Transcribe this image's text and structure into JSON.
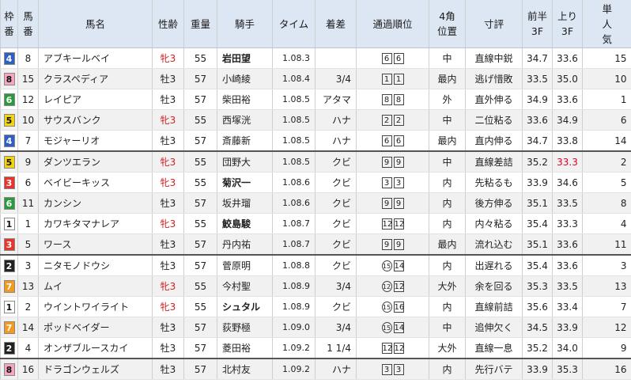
{
  "headers": {
    "waku": [
      "枠",
      "番"
    ],
    "umaban": [
      "馬",
      "番"
    ],
    "horse": "馬名",
    "sexage": "性齢",
    "weight": "重量",
    "jockey": "騎手",
    "time": "タイム",
    "margin": "着差",
    "passing": "通過順位",
    "corner4": [
      "4角",
      "位置"
    ],
    "comment": "寸評",
    "first3f": [
      "前半",
      "3F"
    ],
    "last3f": [
      "上り",
      "3F"
    ],
    "pop": [
      "単",
      "人",
      "気"
    ]
  },
  "colors": {
    "waku1": "#ffffff",
    "waku2": "#222222",
    "waku3": "#e8342c",
    "waku4": "#2f5fc4",
    "waku5": "#f2d30f",
    "waku6": "#2a9a3c",
    "waku7": "#f39a1c",
    "waku8": "#f6a6c2",
    "header_bg": "#dde6f3",
    "highlight": "#e00028"
  },
  "rows": [
    {
      "waku": "4",
      "num": "8",
      "horse": "アブキールベイ",
      "sex": "牝3",
      "weight": "55",
      "jockey": "岩田望",
      "jockey_bold": true,
      "time": "1.08.3",
      "margin": "",
      "pass": [
        "6",
        "6"
      ],
      "c4": "中",
      "comment": "直線中鋭",
      "f3": "34.7",
      "l3": "33.6",
      "pop": "15"
    },
    {
      "waku": "8",
      "num": "15",
      "horse": "クラスペディア",
      "sex": "牡3",
      "weight": "57",
      "jockey": "小崎綾",
      "jockey_bold": false,
      "time": "1.08.4",
      "margin": "3/4",
      "pass": [
        "1",
        "1"
      ],
      "c4": "最内",
      "comment": "逃げ惜敗",
      "f3": "33.5",
      "l3": "35.0",
      "pop": "10"
    },
    {
      "waku": "6",
      "num": "12",
      "horse": "レイピア",
      "sex": "牡3",
      "weight": "57",
      "jockey": "柴田裕",
      "jockey_bold": false,
      "time": "1.08.5",
      "margin": "アタマ",
      "pass": [
        "8",
        "8"
      ],
      "c4": "外",
      "comment": "直外伸る",
      "f3": "34.9",
      "l3": "33.6",
      "pop": "1"
    },
    {
      "waku": "5",
      "num": "10",
      "horse": "サウスバンク",
      "sex": "牝3",
      "weight": "55",
      "jockey": "西塚洸",
      "jockey_bold": false,
      "time": "1.08.5",
      "margin": "ハナ",
      "pass": [
        "2",
        "2"
      ],
      "c4": "中",
      "comment": "二位粘る",
      "f3": "33.6",
      "l3": "34.9",
      "pop": "6"
    },
    {
      "waku": "4",
      "num": "7",
      "horse": "モジャーリオ",
      "sex": "牡3",
      "weight": "57",
      "jockey": "斎藤新",
      "jockey_bold": false,
      "time": "1.08.5",
      "margin": "ハナ",
      "pass": [
        "6",
        "6"
      ],
      "c4": "最内",
      "comment": "直内伸る",
      "f3": "34.7",
      "l3": "33.8",
      "pop": "14"
    },
    {
      "waku": "5",
      "num": "9",
      "horse": "ダンツエラン",
      "sex": "牝3",
      "weight": "55",
      "jockey": "団野大",
      "jockey_bold": false,
      "time": "1.08.5",
      "margin": "クビ",
      "pass": [
        "9",
        "9"
      ],
      "c4": "中",
      "comment": "直線差詰",
      "f3": "35.2",
      "l3": "33.3",
      "pop": "2",
      "l3_hl": true
    },
    {
      "waku": "3",
      "num": "6",
      "horse": "ベイビーキッス",
      "sex": "牝3",
      "weight": "55",
      "jockey": "菊沢一",
      "jockey_bold": true,
      "time": "1.08.6",
      "margin": "クビ",
      "pass": [
        "3",
        "3"
      ],
      "c4": "内",
      "comment": "先粘るも",
      "f3": "33.9",
      "l3": "34.6",
      "pop": "5"
    },
    {
      "waku": "6",
      "num": "11",
      "horse": "カンシン",
      "sex": "牡3",
      "weight": "57",
      "jockey": "坂井瑠",
      "jockey_bold": false,
      "time": "1.08.6",
      "margin": "クビ",
      "pass": [
        "9",
        "9"
      ],
      "c4": "内",
      "comment": "後方伸る",
      "f3": "35.1",
      "l3": "33.5",
      "pop": "8"
    },
    {
      "waku": "1",
      "num": "1",
      "horse": "カワキタマナレア",
      "sex": "牝3",
      "weight": "55",
      "jockey": "鮫島駿",
      "jockey_bold": true,
      "time": "1.08.7",
      "margin": "クビ",
      "pass": [
        "12",
        "12"
      ],
      "c4": "内",
      "comment": "内々粘る",
      "f3": "35.4",
      "l3": "33.3",
      "pop": "4"
    },
    {
      "waku": "3",
      "num": "5",
      "horse": "ワース",
      "sex": "牡3",
      "weight": "57",
      "jockey": "丹内祐",
      "jockey_bold": false,
      "time": "1.08.7",
      "margin": "クビ",
      "pass": [
        "9",
        "9"
      ],
      "c4": "最内",
      "comment": "流れ込む",
      "f3": "35.1",
      "l3": "33.6",
      "pop": "11"
    },
    {
      "waku": "2",
      "num": "3",
      "horse": "ニタモノドウシ",
      "sex": "牡3",
      "weight": "57",
      "jockey": "菅原明",
      "jockey_bold": false,
      "time": "1.08.8",
      "margin": "クビ",
      "pass": [
        "15",
        "14"
      ],
      "pass_circ": [
        true,
        false
      ],
      "c4": "内",
      "comment": "出遅れる",
      "f3": "35.4",
      "l3": "33.6",
      "pop": "3"
    },
    {
      "waku": "7",
      "num": "13",
      "horse": "ムイ",
      "sex": "牝3",
      "weight": "55",
      "jockey": "今村聖",
      "jockey_bold": false,
      "time": "1.08.9",
      "margin": "3/4",
      "pass": [
        "12",
        "12"
      ],
      "pass_circ": [
        true,
        false
      ],
      "c4": "大外",
      "comment": "余を回る",
      "f3": "35.3",
      "l3": "33.5",
      "pop": "13"
    },
    {
      "waku": "1",
      "num": "2",
      "horse": "ウイントワイライト",
      "sex": "牝3",
      "weight": "55",
      "jockey": "シュタル",
      "jockey_bold": true,
      "time": "1.08.9",
      "margin": "クビ",
      "pass": [
        "15",
        "16"
      ],
      "pass_circ": [
        true,
        false
      ],
      "c4": "内",
      "comment": "直線前詰",
      "f3": "35.6",
      "l3": "33.4",
      "pop": "7"
    },
    {
      "waku": "7",
      "num": "14",
      "horse": "ポッドベイダー",
      "sex": "牡3",
      "weight": "57",
      "jockey": "荻野極",
      "jockey_bold": false,
      "time": "1.09.0",
      "margin": "3/4",
      "pass": [
        "15",
        "14"
      ],
      "pass_circ": [
        true,
        false
      ],
      "c4": "中",
      "comment": "追伸欠く",
      "f3": "34.5",
      "l3": "33.9",
      "pop": "12"
    },
    {
      "waku": "2",
      "num": "4",
      "horse": "オンザブルースカイ",
      "sex": "牡3",
      "weight": "57",
      "jockey": "菱田裕",
      "jockey_bold": false,
      "time": "1.09.2",
      "margin": "1 1/4",
      "pass": [
        "12",
        "12"
      ],
      "c4": "大外",
      "comment": "直線一息",
      "f3": "35.2",
      "l3": "34.0",
      "pop": "9"
    },
    {
      "waku": "8",
      "num": "16",
      "horse": "ドラゴンウェルズ",
      "sex": "牡3",
      "weight": "57",
      "jockey": "北村友",
      "jockey_bold": false,
      "time": "1.09.2",
      "margin": "ハナ",
      "pass": [
        "3",
        "3"
      ],
      "c4": "内",
      "comment": "先行バテ",
      "f3": "33.9",
      "l3": "35.3",
      "pop": "16"
    }
  ]
}
